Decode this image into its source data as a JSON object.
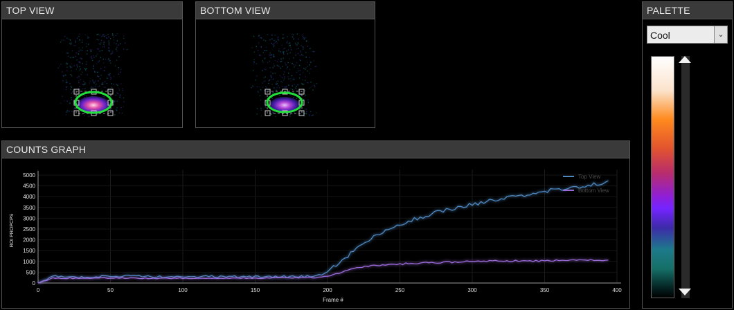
{
  "views": {
    "top": {
      "title": "TOP VIEW"
    },
    "bottom": {
      "title": "BOTTOM VIEW"
    }
  },
  "counts_graph": {
    "title": "COUNTS GRAPH"
  },
  "palette": {
    "title": "PALETTE",
    "selected": "Cool",
    "colors": [
      "#ffffff",
      "#ff8a1e",
      "#8f1fd6",
      "#157067",
      "#000000"
    ]
  },
  "chart_data": {
    "type": "line",
    "xlabel": "Frame #",
    "ylabel": "ROI PROPCPS",
    "xlim": [
      0,
      400
    ],
    "ylim": [
      0,
      5000
    ],
    "xticks": [
      0,
      50,
      100,
      150,
      200,
      250,
      300,
      350,
      400
    ],
    "yticks": [
      0,
      500,
      1000,
      1500,
      2000,
      2500,
      3000,
      3500,
      4000,
      4500,
      5000
    ],
    "legend_position": "top-right",
    "series": [
      {
        "name": "Top View",
        "color": "#4f88c0",
        "x": [
          0,
          10,
          25,
          50,
          75,
          100,
          125,
          150,
          170,
          185,
          195,
          200,
          210,
          220,
          230,
          240,
          250,
          260,
          275,
          290,
          300,
          320,
          340,
          350,
          360,
          380,
          395
        ],
        "y": [
          0,
          300,
          280,
          320,
          300,
          280,
          300,
          280,
          290,
          300,
          380,
          550,
          1000,
          1600,
          2050,
          2400,
          2700,
          2950,
          3250,
          3500,
          3650,
          3900,
          4100,
          4250,
          4350,
          4500,
          4700
        ]
      },
      {
        "name": "Bottom View",
        "color": "#9b6ad9",
        "x": [
          0,
          10,
          25,
          50,
          75,
          100,
          125,
          150,
          175,
          195,
          200,
          210,
          220,
          235,
          250,
          275,
          300,
          325,
          350,
          375,
          395
        ],
        "y": [
          0,
          230,
          220,
          230,
          220,
          220,
          220,
          230,
          240,
          260,
          320,
          500,
          700,
          820,
          880,
          950,
          1000,
          1020,
          1030,
          1050,
          1060
        ]
      }
    ]
  }
}
